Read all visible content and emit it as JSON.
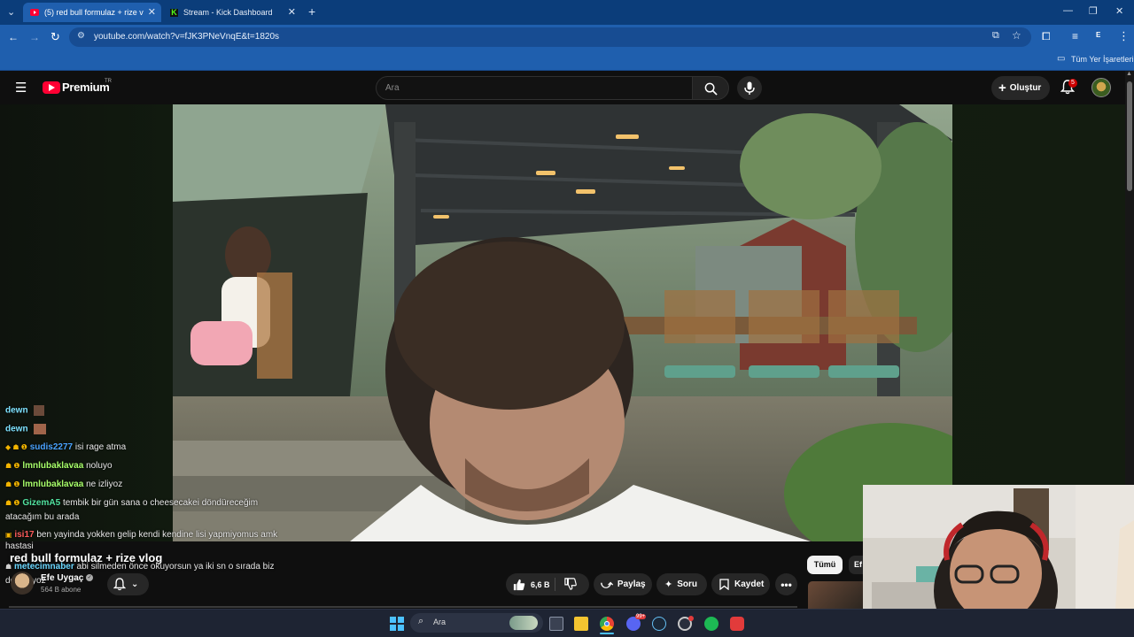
{
  "browser": {
    "tabs": [
      {
        "title": "(5) red bull formulaz + rize vlog",
        "active": true,
        "favicon": "youtube-icon"
      },
      {
        "title": "Stream - Kick Dashboard",
        "active": false,
        "favicon": "kick-icon"
      }
    ],
    "url": "youtube.com/watch?v=fJK3PNeVnqE&t=1820s",
    "bookmarks_label": "Tüm Yer İşaretleri",
    "profile_letter": "E"
  },
  "youtube": {
    "logo_text": "Premium",
    "region": "TR",
    "search_placeholder": "Ara",
    "create_label": "Oluştur",
    "notification_count": "5"
  },
  "chat": [
    {
      "user": "dewn",
      "text": "",
      "color": "#7ee2ff",
      "badges": ""
    },
    {
      "user": "dewn",
      "text": "",
      "color": "#7ee2ff",
      "badges": ""
    },
    {
      "user": "sudis2277",
      "text": "isi rage atma",
      "color": "#4aa3ff",
      "badges": "◆ ☗ ❶"
    },
    {
      "user": "lmnlubaklavaa",
      "text": "noluyo",
      "color": "#a8ff6a",
      "badges": "☗ ❶"
    },
    {
      "user": "lmnlubaklavaa",
      "text": "ne izliyoz",
      "color": "#a8ff6a",
      "badges": "☗ ❶"
    },
    {
      "user": "GizemA5",
      "text": "tembik bir gün sana o cheesecakei döndüreceğim",
      "color": "#52e3a0",
      "badges": "☗ ❶"
    },
    {
      "user": "",
      "text": "atacağım bu arada",
      "color": "#e8e8e8",
      "badges": ""
    },
    {
      "user": "isi17",
      "text": "ben yayinda yokken gelip kendi kendine lisi yapmiyomus amk",
      "color": "#ff5b5b",
      "badges": "▣"
    },
    {
      "user": "",
      "text": "hastasi",
      "color": "#e8e8e8",
      "badges": ""
    },
    {
      "user": "metecimnaber",
      "text": "abi silmeden önce okuyorsun ya iki sn o sırada biz",
      "color": "#6ad7ff",
      "badges": "☗"
    },
    {
      "user": "",
      "text": "de okuyoz",
      "color": "#e8e8e8",
      "badges": ""
    }
  ],
  "video": {
    "title": "red bull formulaz + rize vlog",
    "channel": "Efe Uygaç",
    "subscribers": "564 B abone",
    "likes": "6,6 B",
    "share_label": "Paylaş",
    "ask_label": "Soru",
    "save_label": "Kaydet",
    "chip_all": "Tümü",
    "chip_next": "Ef"
  },
  "taskbar": {
    "search_label": "Ara",
    "discord_badge": "99+"
  },
  "colors": {
    "browser_tabbar": "#0b3d7a",
    "browser_toolbar": "#1f5fae",
    "yt_bg": "#0f0f0f",
    "yt_red": "#ff0033"
  }
}
